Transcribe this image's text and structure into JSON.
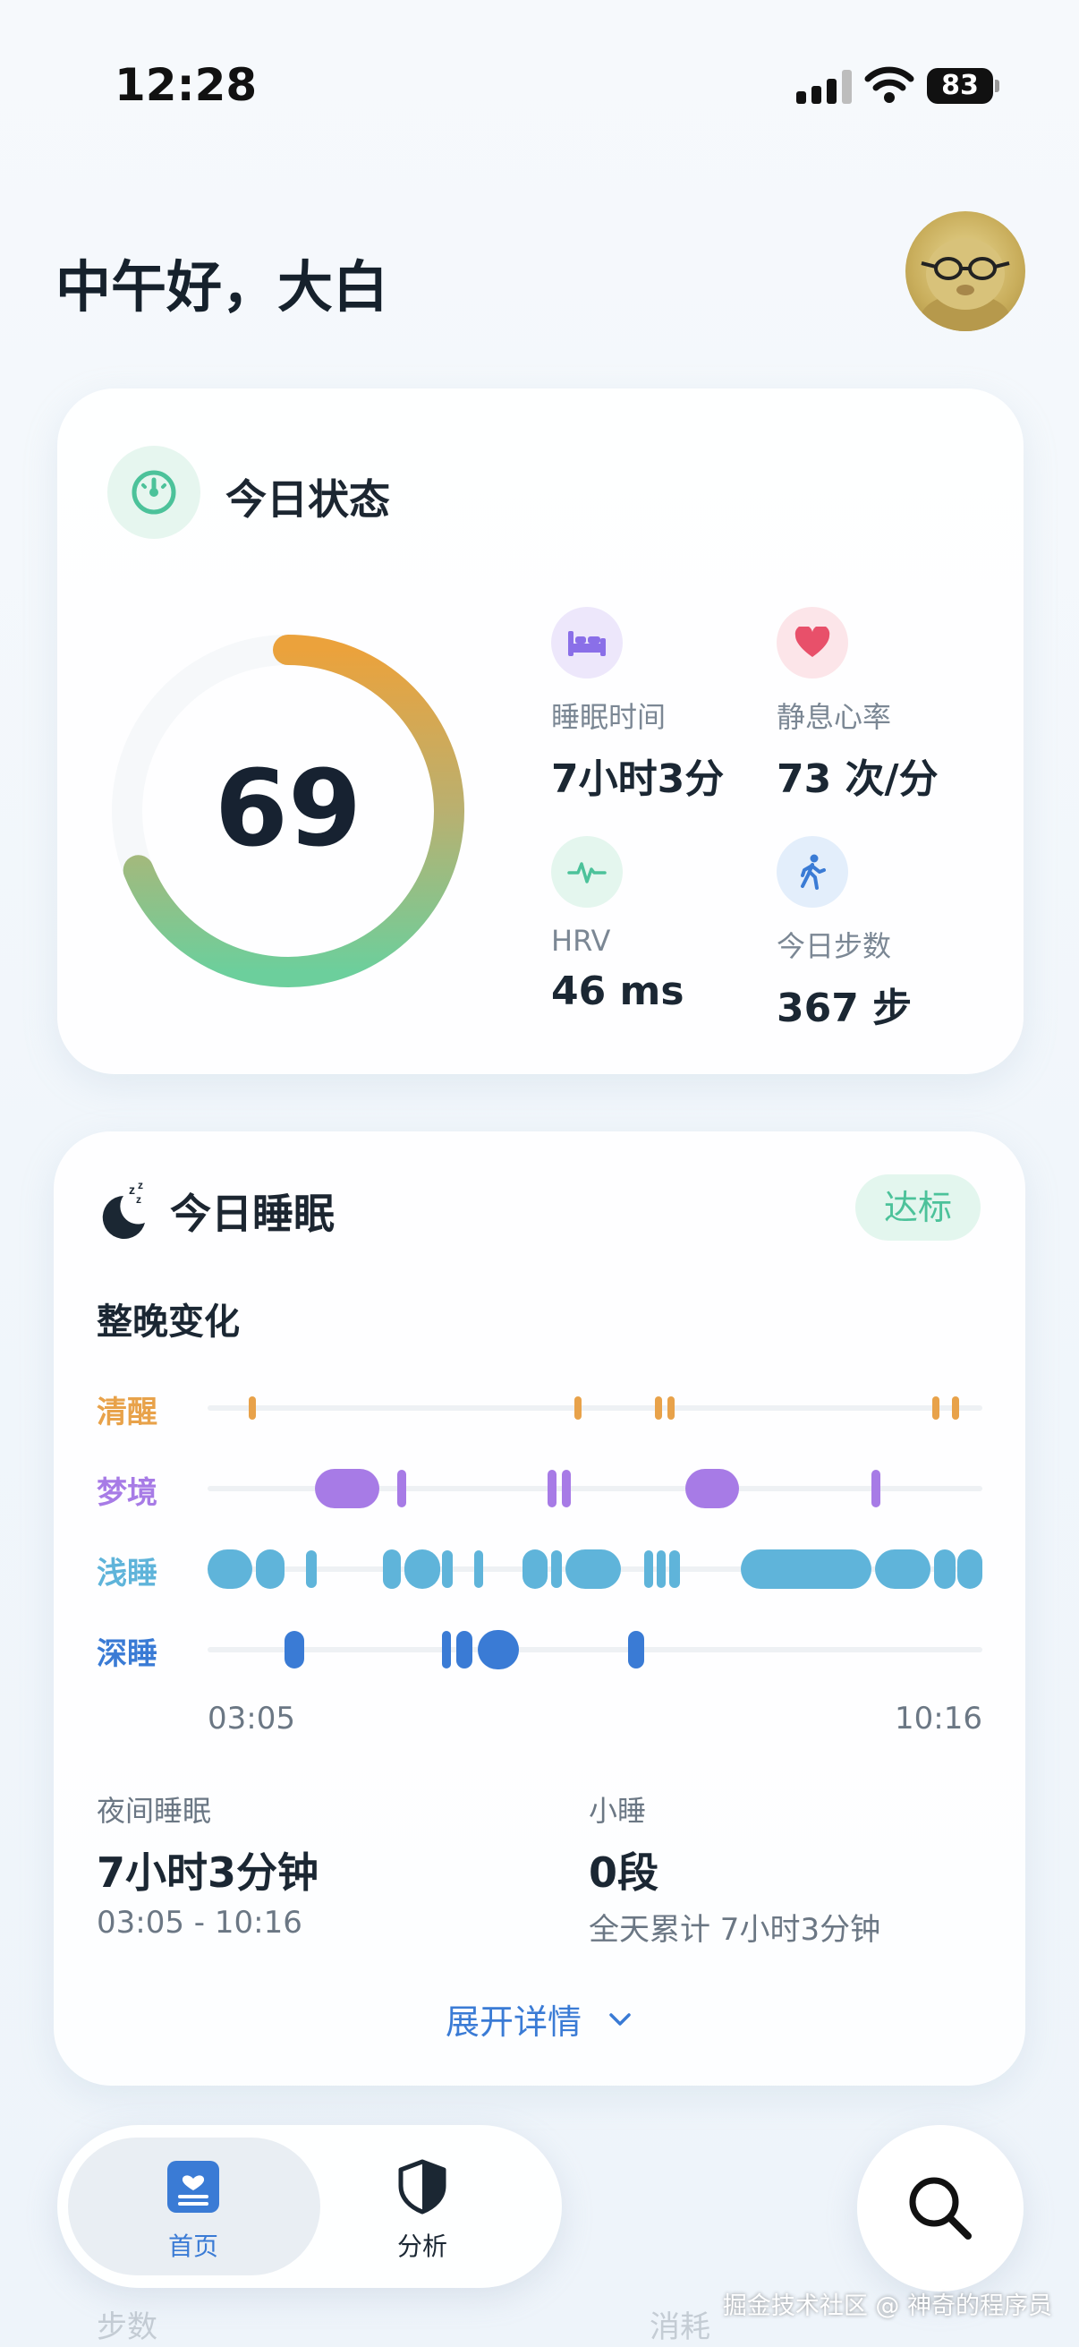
{
  "status_bar": {
    "time": "12:28",
    "battery": "83"
  },
  "greeting": "中午好，大白",
  "status_card": {
    "title": "今日状态",
    "score": "69",
    "score_fraction": 0.69,
    "metrics": [
      {
        "label": "睡眠时间",
        "value": "7小时3分",
        "icon": "bed-icon",
        "color": "#8a6fe8"
      },
      {
        "label": "静息心率",
        "value": "73 次/分",
        "icon": "heart-icon",
        "color": "#e8506a"
      },
      {
        "label": "HRV",
        "value": "46 ms",
        "icon": "pulse-icon",
        "color": "#4cc29a"
      },
      {
        "label": "今日步数",
        "value": "367 步",
        "icon": "walking-icon",
        "color": "#3a7bd5"
      }
    ]
  },
  "sleep_card": {
    "title": "今日睡眠",
    "badge": "达标",
    "subtitle": "整晚变化",
    "stages": [
      {
        "label": "清醒",
        "color": "#e8a24a"
      },
      {
        "label": "梦境",
        "color": "#a77be6"
      },
      {
        "label": "浅睡",
        "color": "#5fb4da"
      },
      {
        "label": "深睡",
        "color": "#3a7bd5"
      }
    ],
    "start_time": "03:05",
    "end_time": "10:16",
    "night_label": "夜间睡眠",
    "night_value": "7小时3分钟",
    "night_range": "03:05 - 10:16",
    "nap_label": "小睡",
    "nap_value": "0段",
    "nap_total": "全天累计 7小时3分钟",
    "expand": "展开详情"
  },
  "behind": {
    "left": "步数",
    "right": "消耗"
  },
  "tabbar": {
    "home": "首页",
    "analysis": "分析"
  },
  "watermark": "掘金技术社区 @ 神奇的程序员"
}
